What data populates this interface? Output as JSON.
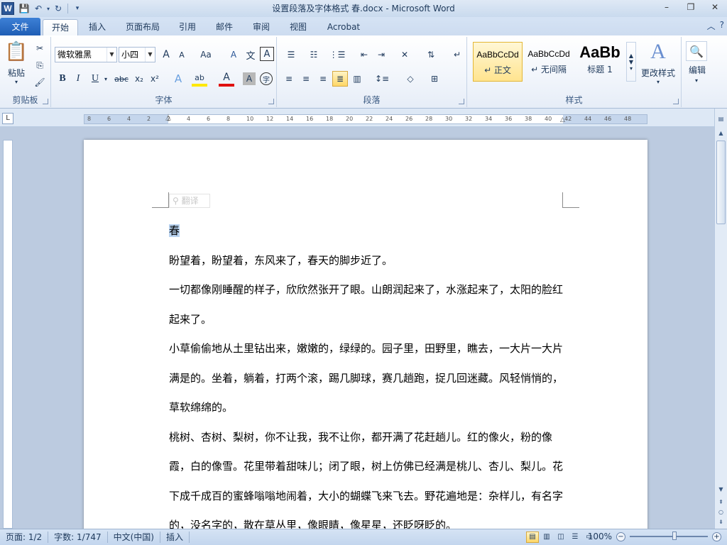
{
  "window": {
    "title": "设置段落及字体格式 春.docx  -  Microsoft Word",
    "qat_logo": "W",
    "min": "–",
    "max": "❐",
    "close": "✕"
  },
  "tabs": {
    "file": "文件",
    "items": [
      "开始",
      "插入",
      "页面布局",
      "引用",
      "邮件",
      "审阅",
      "视图",
      "Acrobat"
    ],
    "active_index": 0
  },
  "ribbon": {
    "clipboard": {
      "label": "剪贴板",
      "paste": "粘贴"
    },
    "font": {
      "label": "字体",
      "font_name": "微软雅黑",
      "font_size": "小四",
      "bold": "B",
      "italic": "I",
      "underline": "U",
      "strike": "abc",
      "sub": "x₂",
      "sup": "x²",
      "grow": "A",
      "shrink": "A",
      "change_case": "Aa",
      "font_color": "A",
      "highlight": "ab",
      "char_shade": "A",
      "enclose": "字",
      "clear": "A",
      "phonetic": "文",
      "border": "A"
    },
    "paragraph": {
      "label": "段落"
    },
    "styles": {
      "label": "样式",
      "items": [
        {
          "sample": "AaBbCcDd",
          "name": "↵ 正文"
        },
        {
          "sample": "AaBbCcDd",
          "name": "↵ 无间隔"
        },
        {
          "sample": "AaBb",
          "name": "标题 1"
        }
      ],
      "change_styles": "更改样式"
    },
    "editing": {
      "label": "编辑"
    }
  },
  "ruler": {
    "ticks": [
      "8",
      "6",
      "4",
      "2",
      "2",
      "4",
      "6",
      "8",
      "10",
      "12",
      "14",
      "16",
      "18",
      "20",
      "22",
      "24",
      "26",
      "28",
      "30",
      "32",
      "34",
      "36",
      "38",
      "40",
      "42",
      "44",
      "46",
      "48"
    ],
    "tab_selector": "L"
  },
  "document": {
    "translate_hint": "翻译",
    "paragraphs": [
      "春",
      "盼望着，盼望着，东风来了，春天的脚步近了。",
      "一切都像刚睡醒的样子，欣欣然张开了眼。山朗润起来了，水涨起来了，太阳的脸红起来了。",
      "小草偷偷地从土里钻出来，嫩嫩的，绿绿的。园子里，田野里，瞧去，一大片一大片满是的。坐着，躺着，打两个滚，踢几脚球，赛几趟跑，捉几回迷藏。风轻悄悄的，草软绵绵的。",
      "桃树、杏树、梨树，你不让我，我不让你，都开满了花赶趟儿。红的像火，粉的像霞，白的像雪。花里带着甜味儿；闭了眼，树上仿佛已经满是桃儿、杏儿、梨儿。花下成千成百的蜜蜂嗡嗡地闹着，大小的蝴蝶飞来飞去。野花遍地是：杂样儿，有名字的，没名字的，散在草丛里，像眼睛，像星星，还眨呀眨的。"
    ]
  },
  "status": {
    "page": "页面: 1/2",
    "words": "字数: 1/747",
    "lang": "中文(中国)",
    "mode": "插入",
    "zoom": "100%"
  }
}
